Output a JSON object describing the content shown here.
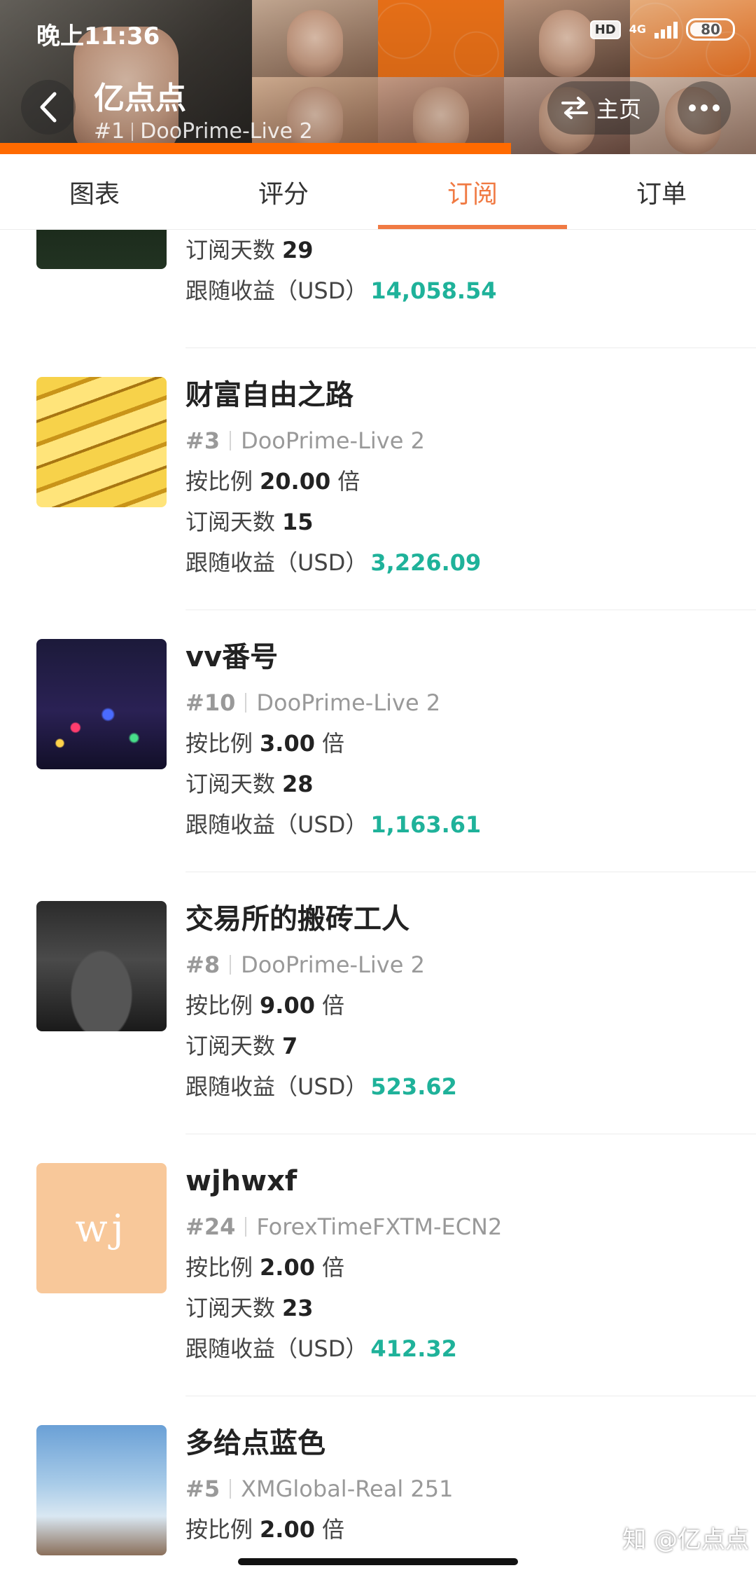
{
  "status_bar": {
    "time": "晚上11:36",
    "hd_label": "HD",
    "network": "4G",
    "battery": "80",
    "battery_level": 0.8
  },
  "header": {
    "title": "亿点点",
    "rank": "#1",
    "server": "DooPrime-Live 2",
    "home_label": "主页",
    "back_icon": "chevron-left-icon",
    "switch_icon": "swap-arrows-icon",
    "more_icon": "more-dots-icon"
  },
  "tabs": [
    {
      "label": "图表",
      "active": false
    },
    {
      "label": "评分",
      "active": false
    },
    {
      "label": "订阅",
      "active": true
    },
    {
      "label": "订单",
      "active": false
    }
  ],
  "labels": {
    "ratio_prefix": "按比例",
    "ratio_suffix": "倍",
    "days": "订阅天数",
    "profit": "跟随收益（USD）"
  },
  "partial_item": {
    "days_value": "29",
    "profit_value": "14,058.54"
  },
  "items": [
    {
      "name": "财富自由之路",
      "rank": "#3",
      "server": "DooPrime-Live 2",
      "ratio": "20.00",
      "days": "15",
      "profit": "3,226.09",
      "thumb": "gold-bars-image"
    },
    {
      "name": "vv番号",
      "rank": "#10",
      "server": "DooPrime-Live 2",
      "ratio": "3.00",
      "days": "28",
      "profit": "1,163.61",
      "thumb": "night-lights-image"
    },
    {
      "name": "交易所的搬砖工人",
      "rank": "#8",
      "server": "DooPrime-Live 2",
      "ratio": "9.00",
      "days": "7",
      "profit": "523.62",
      "thumb": "sports-car-image"
    },
    {
      "name": "wjhwxf",
      "rank": "#24",
      "server": "ForexTimeFXTM-ECN2",
      "ratio": "2.00",
      "days": "23",
      "profit": "412.32",
      "thumb": "wj-avatar",
      "thumb_text": "wj"
    },
    {
      "name": "多给点蓝色",
      "rank": "#5",
      "server": "XMGlobal-Real 251",
      "ratio": "2.00",
      "thumb": "sky-branches-image"
    }
  ],
  "watermark": "知 @亿点点"
}
